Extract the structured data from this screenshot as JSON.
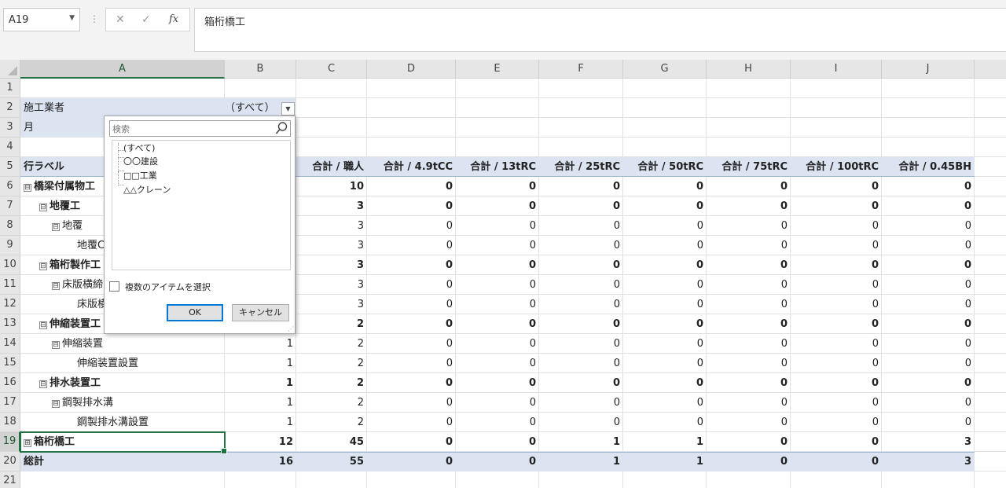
{
  "formula_bar": {
    "cell_ref": "A19",
    "cancel_icon": "✕",
    "enter_icon": "✓",
    "fx_icon": "fx",
    "content": "箱桁橋工"
  },
  "columns": [
    "A",
    "B",
    "C",
    "D",
    "E",
    "F",
    "G",
    "H",
    "I",
    "J"
  ],
  "rows": [
    "1",
    "2",
    "3",
    "4",
    "5",
    "6",
    "7",
    "8",
    "9",
    "10",
    "11",
    "12",
    "13",
    "14",
    "15",
    "16",
    "17",
    "18",
    "19",
    "20",
    "21"
  ],
  "filters": {
    "vendor_label": "施工業者",
    "vendor_value": "（すべて）",
    "month_label": "月"
  },
  "pivot": {
    "row_label_header": "行ラベル",
    "headers": [
      "合計 / 職人",
      "合計 / 4.9tCC",
      "合計 / 13tRC",
      "合計 / 25tRC",
      "合計 / 50tRC",
      "合計 / 75tRC",
      "合計 / 100tRC",
      "合計 / 0.45BH"
    ],
    "rows": [
      {
        "label": "橋梁付属物工",
        "toggle": "⊟",
        "bold": true,
        "b": "",
        "c": "10",
        "v": [
          "0",
          "0",
          "0",
          "0",
          "0",
          "0",
          "0"
        ]
      },
      {
        "label": "地覆工",
        "toggle": "⊟",
        "bold": true,
        "b": "",
        "c": "3",
        "v": [
          "0",
          "0",
          "0",
          "0",
          "0",
          "0",
          "0"
        ]
      },
      {
        "label": "地覆",
        "toggle": "⊟",
        "bold": false,
        "b": "",
        "c": "3",
        "v": [
          "0",
          "0",
          "0",
          "0",
          "0",
          "0",
          "0"
        ]
      },
      {
        "label": "地覆C",
        "toggle": "",
        "bold": false,
        "b": "",
        "c": "3",
        "v": [
          "0",
          "0",
          "0",
          "0",
          "0",
          "0",
          "0"
        ]
      },
      {
        "label": "箱桁製作工",
        "toggle": "⊟",
        "bold": true,
        "b": "",
        "c": "3",
        "v": [
          "0",
          "0",
          "0",
          "0",
          "0",
          "0",
          "0"
        ]
      },
      {
        "label": "床版横締",
        "toggle": "⊟",
        "bold": false,
        "b": "",
        "c": "3",
        "v": [
          "0",
          "0",
          "0",
          "0",
          "0",
          "0",
          "0"
        ]
      },
      {
        "label": "床版横",
        "toggle": "",
        "bold": false,
        "b": "",
        "c": "3",
        "v": [
          "0",
          "0",
          "0",
          "0",
          "0",
          "0",
          "0"
        ]
      },
      {
        "label": "伸縮装置工",
        "toggle": "⊟",
        "bold": true,
        "b": "",
        "c": "2",
        "v": [
          "0",
          "0",
          "0",
          "0",
          "0",
          "0",
          "0"
        ]
      },
      {
        "label": "伸縮装置",
        "toggle": "⊟",
        "bold": false,
        "b": "1",
        "c": "2",
        "v": [
          "0",
          "0",
          "0",
          "0",
          "0",
          "0",
          "0"
        ]
      },
      {
        "label": "伸縮装置設置",
        "toggle": "",
        "bold": false,
        "b": "1",
        "c": "2",
        "v": [
          "0",
          "0",
          "0",
          "0",
          "0",
          "0",
          "0"
        ]
      },
      {
        "label": "排水装置工",
        "toggle": "⊟",
        "bold": true,
        "b": "1",
        "c": "2",
        "v": [
          "0",
          "0",
          "0",
          "0",
          "0",
          "0",
          "0"
        ]
      },
      {
        "label": "鋼製排水溝",
        "toggle": "⊟",
        "bold": false,
        "b": "1",
        "c": "2",
        "v": [
          "0",
          "0",
          "0",
          "0",
          "0",
          "0",
          "0"
        ]
      },
      {
        "label": "鋼製排水溝設置",
        "toggle": "",
        "bold": false,
        "b": "1",
        "c": "2",
        "v": [
          "0",
          "0",
          "0",
          "0",
          "0",
          "0",
          "0"
        ]
      },
      {
        "label": "箱桁橋工",
        "toggle": "⊞",
        "bold": true,
        "b": "12",
        "c": "45",
        "v": [
          "0",
          "0",
          "1",
          "1",
          "0",
          "0",
          "3"
        ]
      },
      {
        "label": "総計",
        "toggle": "",
        "bold": true,
        "b": "16",
        "c": "55",
        "v": [
          "0",
          "0",
          "1",
          "1",
          "0",
          "0",
          "3"
        ]
      }
    ]
  },
  "filter_popup": {
    "search_placeholder": "検索",
    "items": [
      "(すべて)",
      "〇〇建設",
      "□□工業",
      "△△クレーン"
    ],
    "multi_select_label": "複数のアイテムを選択",
    "ok_label": "OK",
    "cancel_label": "キャンセル"
  }
}
